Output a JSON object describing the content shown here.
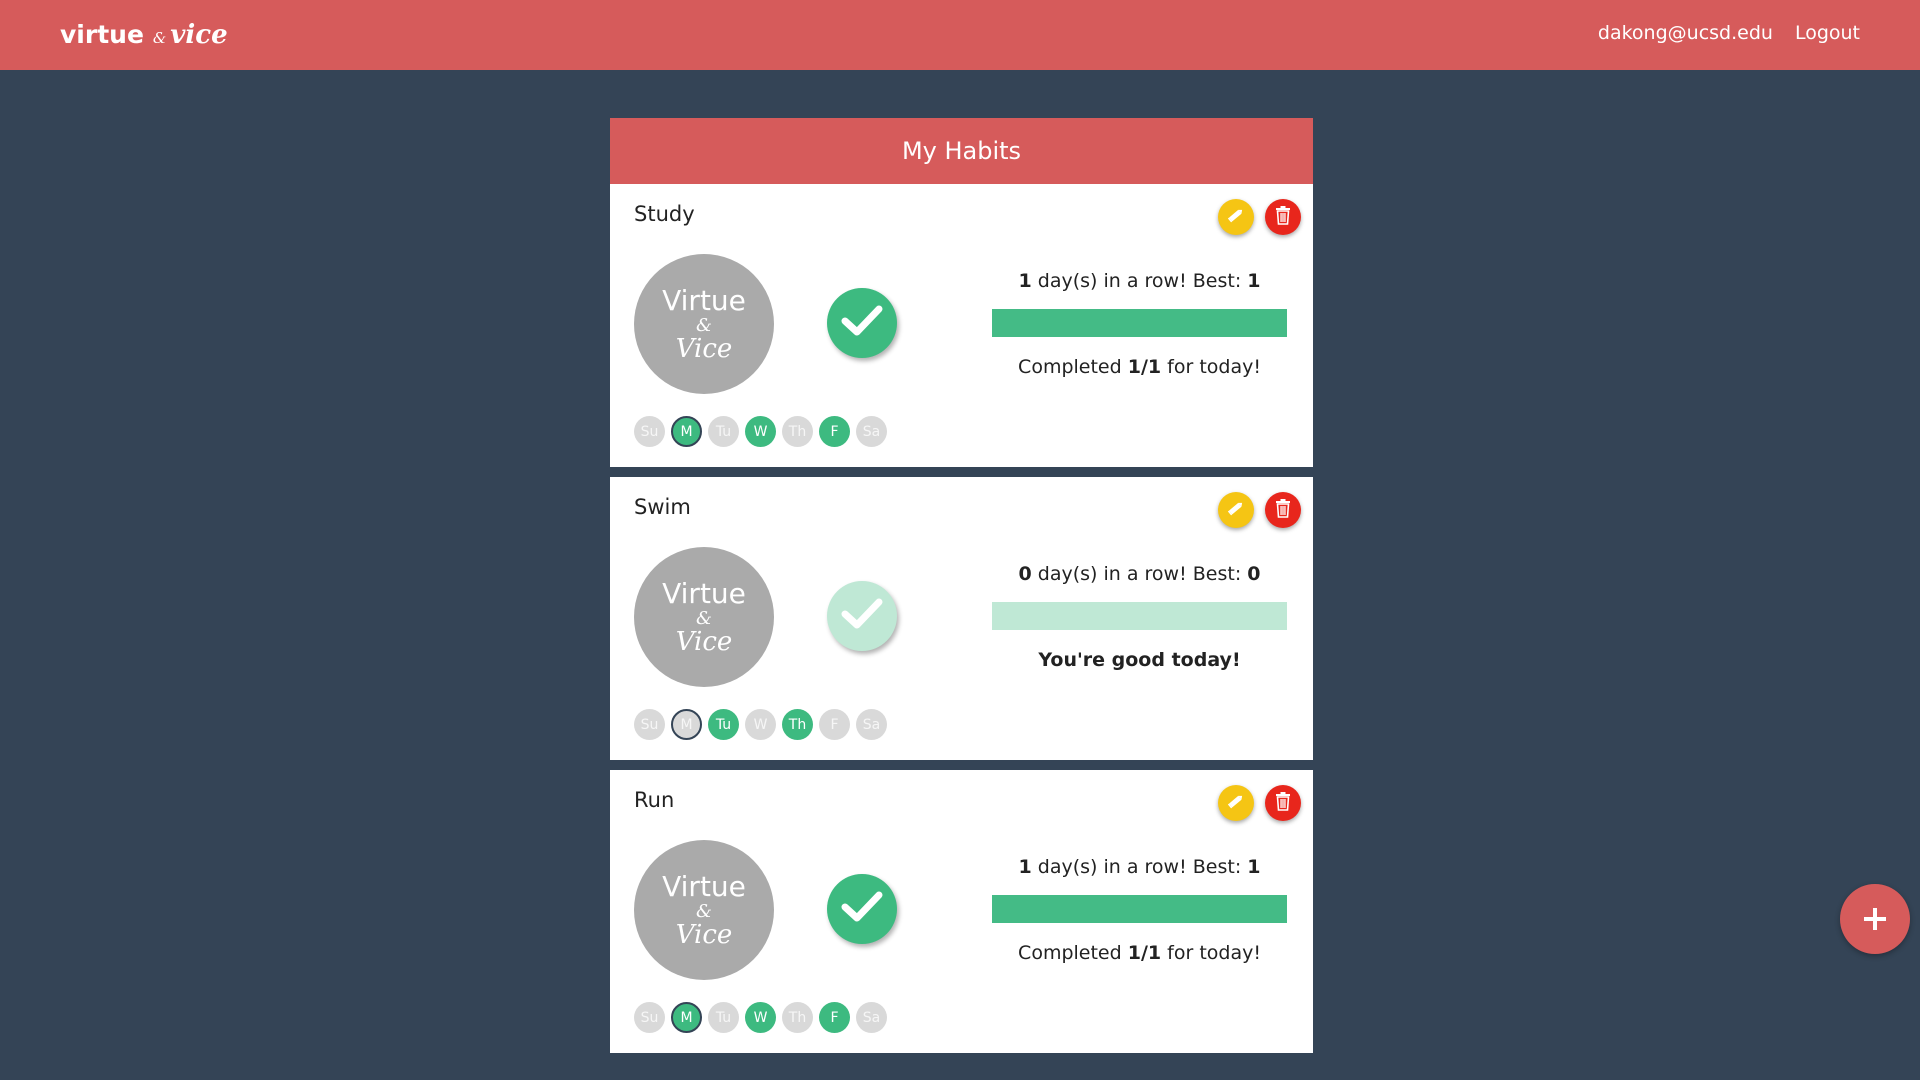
{
  "nav": {
    "brand_main": "virtue",
    "brand_amp": "&",
    "brand_vice": "vice",
    "user_email": "dakong@ucsd.edu",
    "logout_label": "Logout"
  },
  "panel": {
    "title": "My Habits"
  },
  "habits": [
    {
      "name": "Study",
      "logo": {
        "top": "Virtue",
        "amp": "&",
        "bottom": "Vice"
      },
      "streak": "1",
      "streak_text": " day(s) in a row! Best: ",
      "best": "1",
      "progress": 1.0,
      "completed": true,
      "status_prefix": "Completed ",
      "status_count": "1/1",
      "status_suffix": " for today!",
      "days": [
        {
          "label": "Su",
          "active": false,
          "today": false
        },
        {
          "label": "M",
          "active": true,
          "today": true
        },
        {
          "label": "Tu",
          "active": false,
          "today": false
        },
        {
          "label": "W",
          "active": true,
          "today": false
        },
        {
          "label": "Th",
          "active": false,
          "today": false
        },
        {
          "label": "F",
          "active": true,
          "today": false
        },
        {
          "label": "Sa",
          "active": false,
          "today": false
        }
      ]
    },
    {
      "name": "Swim",
      "logo": {
        "top": "Virtue",
        "amp": "&",
        "bottom": "Vice"
      },
      "streak": "0",
      "streak_text": " day(s) in a row! Best: ",
      "best": "0",
      "progress": 0.0,
      "completed": false,
      "status_full": "You're good today!",
      "days": [
        {
          "label": "Su",
          "active": false,
          "today": false
        },
        {
          "label": "M",
          "active": false,
          "today": true
        },
        {
          "label": "Tu",
          "active": true,
          "today": false
        },
        {
          "label": "W",
          "active": false,
          "today": false
        },
        {
          "label": "Th",
          "active": true,
          "today": false
        },
        {
          "label": "F",
          "active": false,
          "today": false
        },
        {
          "label": "Sa",
          "active": false,
          "today": false
        }
      ]
    },
    {
      "name": "Run",
      "logo": {
        "top": "Virtue",
        "amp": "&",
        "bottom": "Vice"
      },
      "streak": "1",
      "streak_text": " day(s) in a row! Best: ",
      "best": "1",
      "progress": 1.0,
      "completed": true,
      "status_prefix": "Completed ",
      "status_count": "1/1",
      "status_suffix": " for today!",
      "days": [
        {
          "label": "Su",
          "active": false,
          "today": false
        },
        {
          "label": "M",
          "active": true,
          "today": true
        },
        {
          "label": "Tu",
          "active": false,
          "today": false
        },
        {
          "label": "W",
          "active": true,
          "today": false
        },
        {
          "label": "Th",
          "active": false,
          "today": false
        },
        {
          "label": "F",
          "active": true,
          "today": false
        },
        {
          "label": "Sa",
          "active": false,
          "today": false
        }
      ]
    }
  ],
  "fab": {
    "icon": "plus-icon",
    "label": "+"
  },
  "icons": {
    "edit": "pencil-icon",
    "delete": "trash-icon",
    "check": "check-icon"
  },
  "colors": {
    "brand_red": "#d65b5b",
    "background": "#344456",
    "green": "#3dba80",
    "green_light": "#bfe8d5",
    "edit_yellow": "#f5c514",
    "delete_red": "#e8261c",
    "day_inactive": "#d9d9d9",
    "logo_gray": "#aaaaaa"
  }
}
